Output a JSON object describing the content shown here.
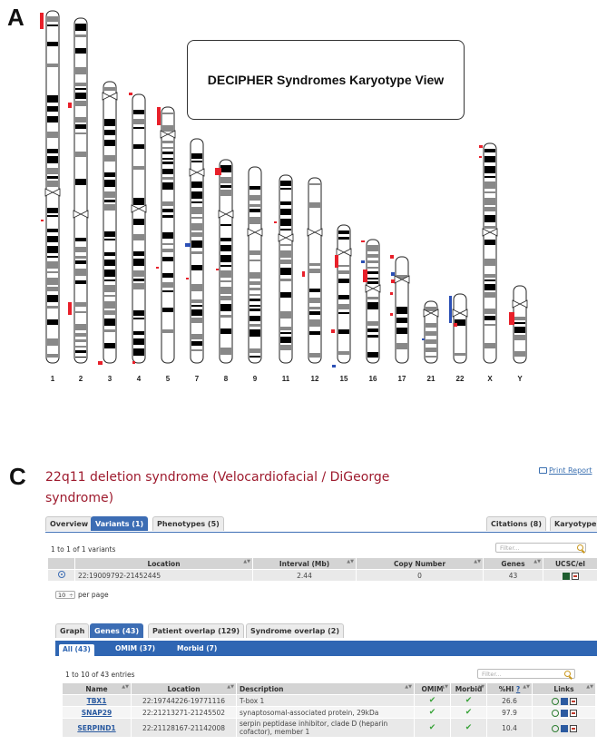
{
  "panel_a": {
    "letter": "A",
    "view_title": "DECIPHER Syndromes Karyotype View"
  },
  "chromosome_labels": [
    "1",
    "2",
    "3",
    "4",
    "5",
    "7",
    "8",
    "9",
    "11",
    "12",
    "15",
    "16",
    "17",
    "21",
    "22",
    "X",
    "Y"
  ],
  "panel_c": {
    "letter": "C",
    "syndrome_title": "22q11 deletion syndrome (Velocardiofacial / DiGeorge syndrome)",
    "print_label": "Print Report",
    "main_tabs": [
      {
        "label": "Overview",
        "active": false
      },
      {
        "label": "Variants (1)",
        "active": true
      },
      {
        "label": "Phenotypes (5)",
        "active": false
      }
    ],
    "right_tabs": [
      {
        "label": "Citations (8)"
      },
      {
        "label": "Karyotype"
      }
    ],
    "variants": {
      "summary": "1 to 1 of 1 variants",
      "filter_placeholder": "Filter...",
      "headers": [
        "Location",
        "Interval (Mb)",
        "Copy Number",
        "Genes",
        "UCSC/el"
      ],
      "rows": [
        {
          "location": "22:19009792-21452445",
          "interval": "2.44",
          "copy_number": "0",
          "genes": "43"
        }
      ],
      "per_page_value": "10",
      "per_page_label": "per page"
    },
    "gene_tabs": [
      {
        "label": "Graph",
        "active": false
      },
      {
        "label": "Genes (43)",
        "active": true
      },
      {
        "label": "Patient overlap (129)",
        "active": false
      },
      {
        "label": "Syndrome overlap (2)",
        "active": false
      }
    ],
    "gene_subtabs": [
      {
        "label": "All (43)",
        "active": true
      },
      {
        "label": "OMIM (37)",
        "active": false
      },
      {
        "label": "Morbid (7)",
        "active": false
      }
    ],
    "genes": {
      "summary": "1 to 10 of 43 entries",
      "filter_placeholder": "Filter...",
      "headers": [
        "Name",
        "Location",
        "Description",
        "OMIM",
        "Morbid",
        "%HI",
        "Links"
      ],
      "hi_help": "?",
      "rows": [
        {
          "name": "TBX1",
          "location": "22:19744226-19771116",
          "description": "T-box 1",
          "hi": "26.6"
        },
        {
          "name": "SNAP29",
          "location": "22:21213271-21245502",
          "description": "synaptosomal-associated protein, 29kDa",
          "hi": "97.9"
        },
        {
          "name": "SERPIND1",
          "location": "22:21128167-21142008",
          "description": "serpin peptidase inhibitor, clade D (heparin cofactor), member 1",
          "hi": "10.4"
        }
      ]
    }
  },
  "colors": {
    "accent": "#3c6db4",
    "title_red": "#9e1b2e",
    "mark_red": "#e8202a",
    "mark_blue": "#2b4fb5"
  }
}
